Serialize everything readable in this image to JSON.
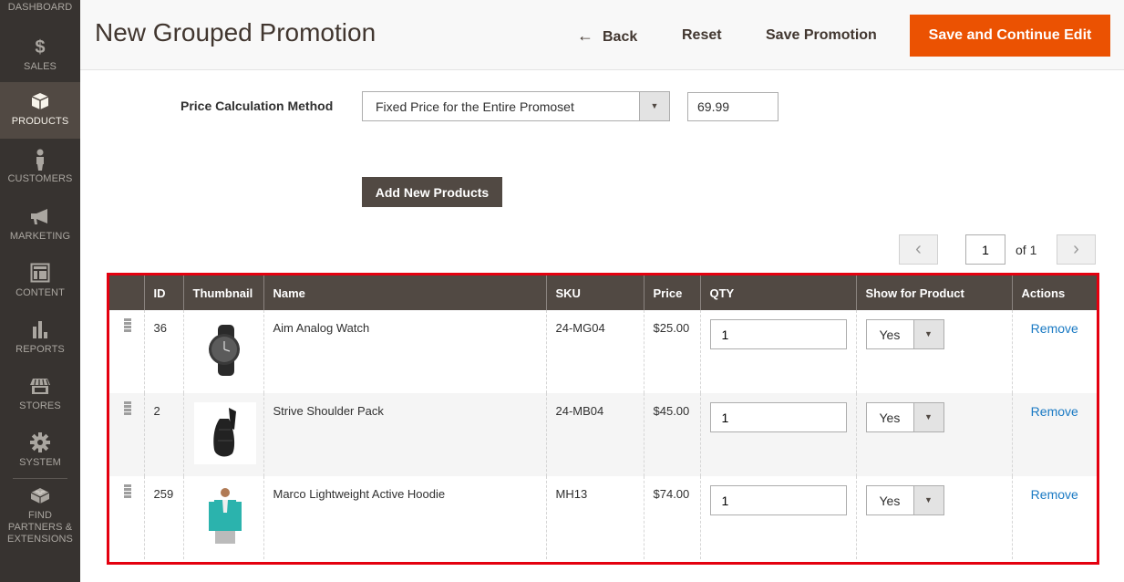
{
  "sidebar": {
    "items": [
      {
        "label": "DASHBOARD",
        "icon": "dashboard-icon",
        "active": false
      },
      {
        "label": "SALES",
        "icon": "dollar-icon",
        "active": false
      },
      {
        "label": "PRODUCTS",
        "icon": "box-icon",
        "active": true
      },
      {
        "label": "CUSTOMERS",
        "icon": "person-icon",
        "active": false
      },
      {
        "label": "MARKETING",
        "icon": "megaphone-icon",
        "active": false
      },
      {
        "label": "CONTENT",
        "icon": "layout-icon",
        "active": false
      },
      {
        "label": "REPORTS",
        "icon": "bar-chart-icon",
        "active": false
      },
      {
        "label": "STORES",
        "icon": "storefront-icon",
        "active": false
      },
      {
        "label": "SYSTEM",
        "icon": "gear-icon",
        "active": false
      },
      {
        "label": "FIND PARTNERS & EXTENSIONS",
        "icon": "lego-brick-icon",
        "active": false
      }
    ]
  },
  "header": {
    "title": "New Grouped Promotion",
    "back_label": "Back",
    "reset_label": "Reset",
    "save_label": "Save Promotion",
    "save_continue_label": "Save and Continue Edit"
  },
  "form": {
    "price_method_label": "Price Calculation Method",
    "price_method_value": "Fixed Price for the Entire Promoset",
    "price_value": "69.99",
    "add_products_label": "Add New Products"
  },
  "pager": {
    "current": "1",
    "of_label": "of 1"
  },
  "grid": {
    "columns": [
      "",
      "ID",
      "Thumbnail",
      "Name",
      "SKU",
      "Price",
      "QTY",
      "Show for Product",
      "Actions"
    ],
    "rows": [
      {
        "id": "36",
        "thumbnail": "watch",
        "name": "Aim Analog Watch",
        "sku": "24-MG04",
        "price": "$25.00",
        "qty": "1",
        "show": "Yes",
        "action": "Remove"
      },
      {
        "id": "2",
        "thumbnail": "shoulder-pack",
        "name": "Strive Shoulder Pack",
        "sku": "24-MB04",
        "price": "$45.00",
        "qty": "1",
        "show": "Yes",
        "action": "Remove"
      },
      {
        "id": "259",
        "thumbnail": "hoodie",
        "name": "Marco Lightweight Active Hoodie",
        "sku": "MH13",
        "price": "$74.00",
        "qty": "1",
        "show": "Yes",
        "action": "Remove"
      }
    ]
  },
  "colors": {
    "primary": "#eb5202",
    "sidebar": "#373330",
    "grid_header": "#514943",
    "highlight_border": "#e4000f",
    "link": "#1979c3"
  }
}
